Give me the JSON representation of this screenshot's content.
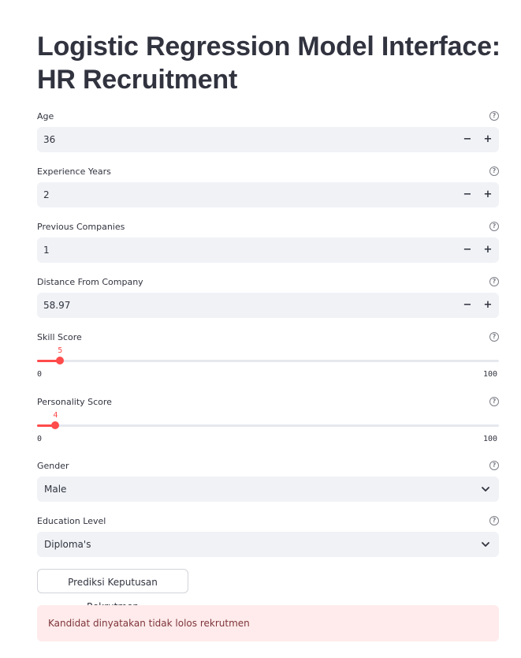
{
  "page": {
    "title": "Logistic Regression Model Interface: HR Recruitment"
  },
  "accent_color": "#ff4b4b",
  "fields": {
    "age": {
      "label": "Age",
      "value": "36"
    },
    "experience_years": {
      "label": "Experience Years",
      "value": "2"
    },
    "previous_companies": {
      "label": "Previous Companies",
      "value": "1"
    },
    "distance_from_company": {
      "label": "Distance From Company",
      "value": "58.97"
    }
  },
  "stepper": {
    "minus": "−",
    "plus": "+"
  },
  "help_icon": "?",
  "sliders": {
    "skill_score": {
      "label": "Skill Score",
      "value": 5,
      "value_text": "5",
      "min": "0",
      "max": "100"
    },
    "personality_score": {
      "label": "Personality Score",
      "value": 4,
      "value_text": "4",
      "min": "0",
      "max": "100"
    }
  },
  "selects": {
    "gender": {
      "label": "Gender",
      "value": "Male"
    },
    "education_level": {
      "label": "Education Level",
      "value": "Diploma's"
    }
  },
  "predict_button": "Prediksi Keputusan Rekrutmen",
  "result": {
    "message": "Kandidat dinyatakan tidak lolos rekrutmen"
  }
}
